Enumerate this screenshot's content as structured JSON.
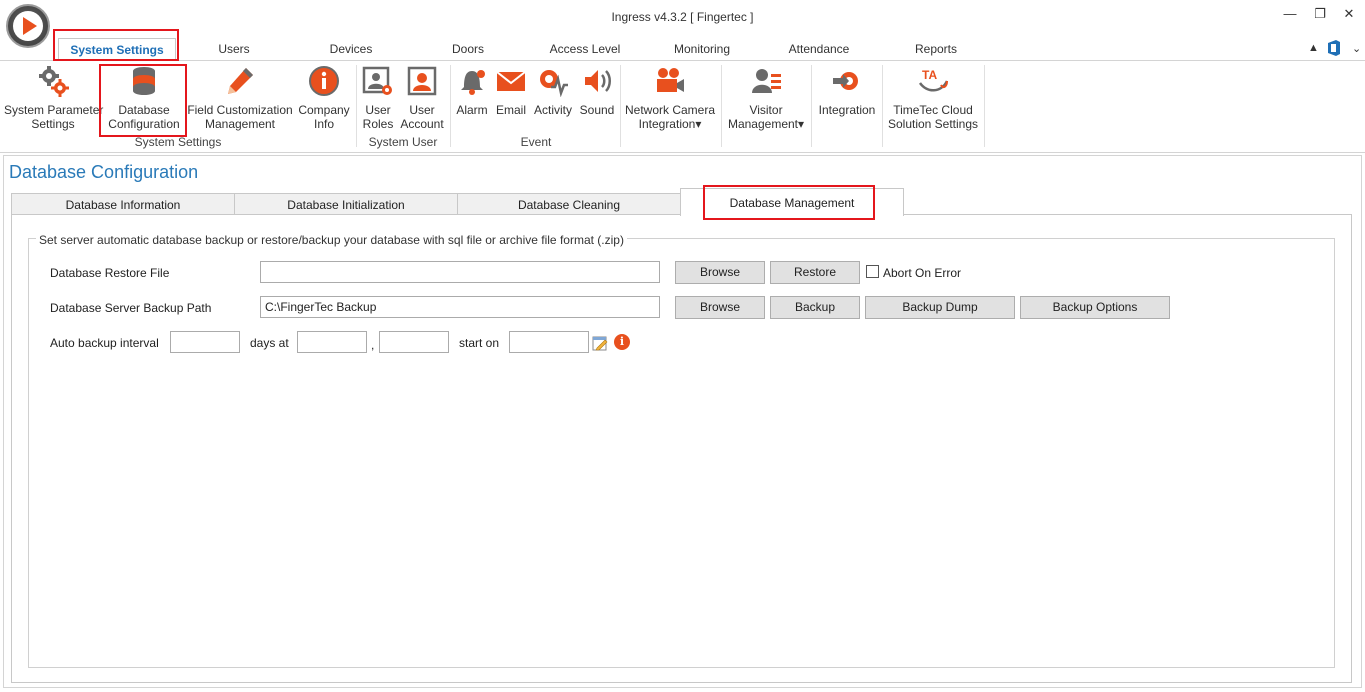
{
  "window": {
    "title": "Ingress v4.3.2 [ Fingertec ]",
    "minimize": "—",
    "restore": "❐",
    "close": "✕"
  },
  "menu_tabs": [
    "System Settings",
    "Users",
    "Devices",
    "Doors",
    "Access Level",
    "Monitoring",
    "Attendance",
    "Reports"
  ],
  "ribbon": {
    "system_settings": {
      "group": "System Settings",
      "buttons": [
        {
          "line1": "System Parameter",
          "line2": "Settings",
          "icon": "gears-icon"
        },
        {
          "line1": "Database",
          "line2": "Configuration",
          "icon": "database-icon"
        },
        {
          "line1": "Field Customization",
          "line2": "Management",
          "icon": "pencil-icon"
        },
        {
          "line1": "Company",
          "line2": "Info",
          "icon": "info-icon"
        }
      ]
    },
    "system_user": {
      "group": "System User",
      "buttons": [
        {
          "line1": "User",
          "line2": "Roles",
          "icon": "user-roles-icon"
        },
        {
          "line1": "User",
          "line2": "Account",
          "icon": "user-account-icon"
        }
      ]
    },
    "event": {
      "group": "Event",
      "buttons": [
        {
          "line1": "Alarm",
          "icon": "bell-icon"
        },
        {
          "line1": "Email",
          "icon": "email-icon"
        },
        {
          "line1": "Activity",
          "icon": "activity-icon"
        },
        {
          "line1": "Sound",
          "icon": "speaker-icon"
        }
      ]
    },
    "others": [
      {
        "line1": "Network Camera",
        "line2": "Integration",
        "dropdown": "▾",
        "icon": "camera-icon"
      },
      {
        "line1": "Visitor",
        "line2": "Management",
        "dropdown": "▾",
        "icon": "visitor-icon"
      },
      {
        "line1": "Integration",
        "icon": "integration-icon"
      },
      {
        "line1": "TimeTec Cloud",
        "line2": "Solution Settings",
        "icon": "timetec-icon",
        "logo_text": "TA"
      }
    ]
  },
  "page": {
    "title": "Database Configuration",
    "tabs": [
      "Database Information",
      "Database Initialization",
      "Database Cleaning",
      "Database Management"
    ],
    "active_tab": "Database Management",
    "groupbox_caption": "Set server automatic database backup or restore/backup your database with sql file or archive file format (.zip)",
    "restore": {
      "label": "Database Restore File",
      "value": "",
      "browse": "Browse",
      "restore": "Restore",
      "abort_label": "Abort On Error",
      "abort_checked": false
    },
    "backup": {
      "label": "Database Server Backup Path",
      "value": "C:\\FingerTec Backup",
      "browse": "Browse",
      "backup": "Backup",
      "dump": "Backup Dump",
      "options": "Backup Options"
    },
    "auto": {
      "label": "Auto backup interval",
      "interval": "",
      "days_at": "days at",
      "hour": "",
      "comma": ",",
      "minute": "",
      "start_on": "start on",
      "start_date": ""
    }
  },
  "colors": {
    "accent_blue": "#1f6fb6",
    "highlight_red": "#e4161c",
    "icon_orange": "#e8501e"
  }
}
